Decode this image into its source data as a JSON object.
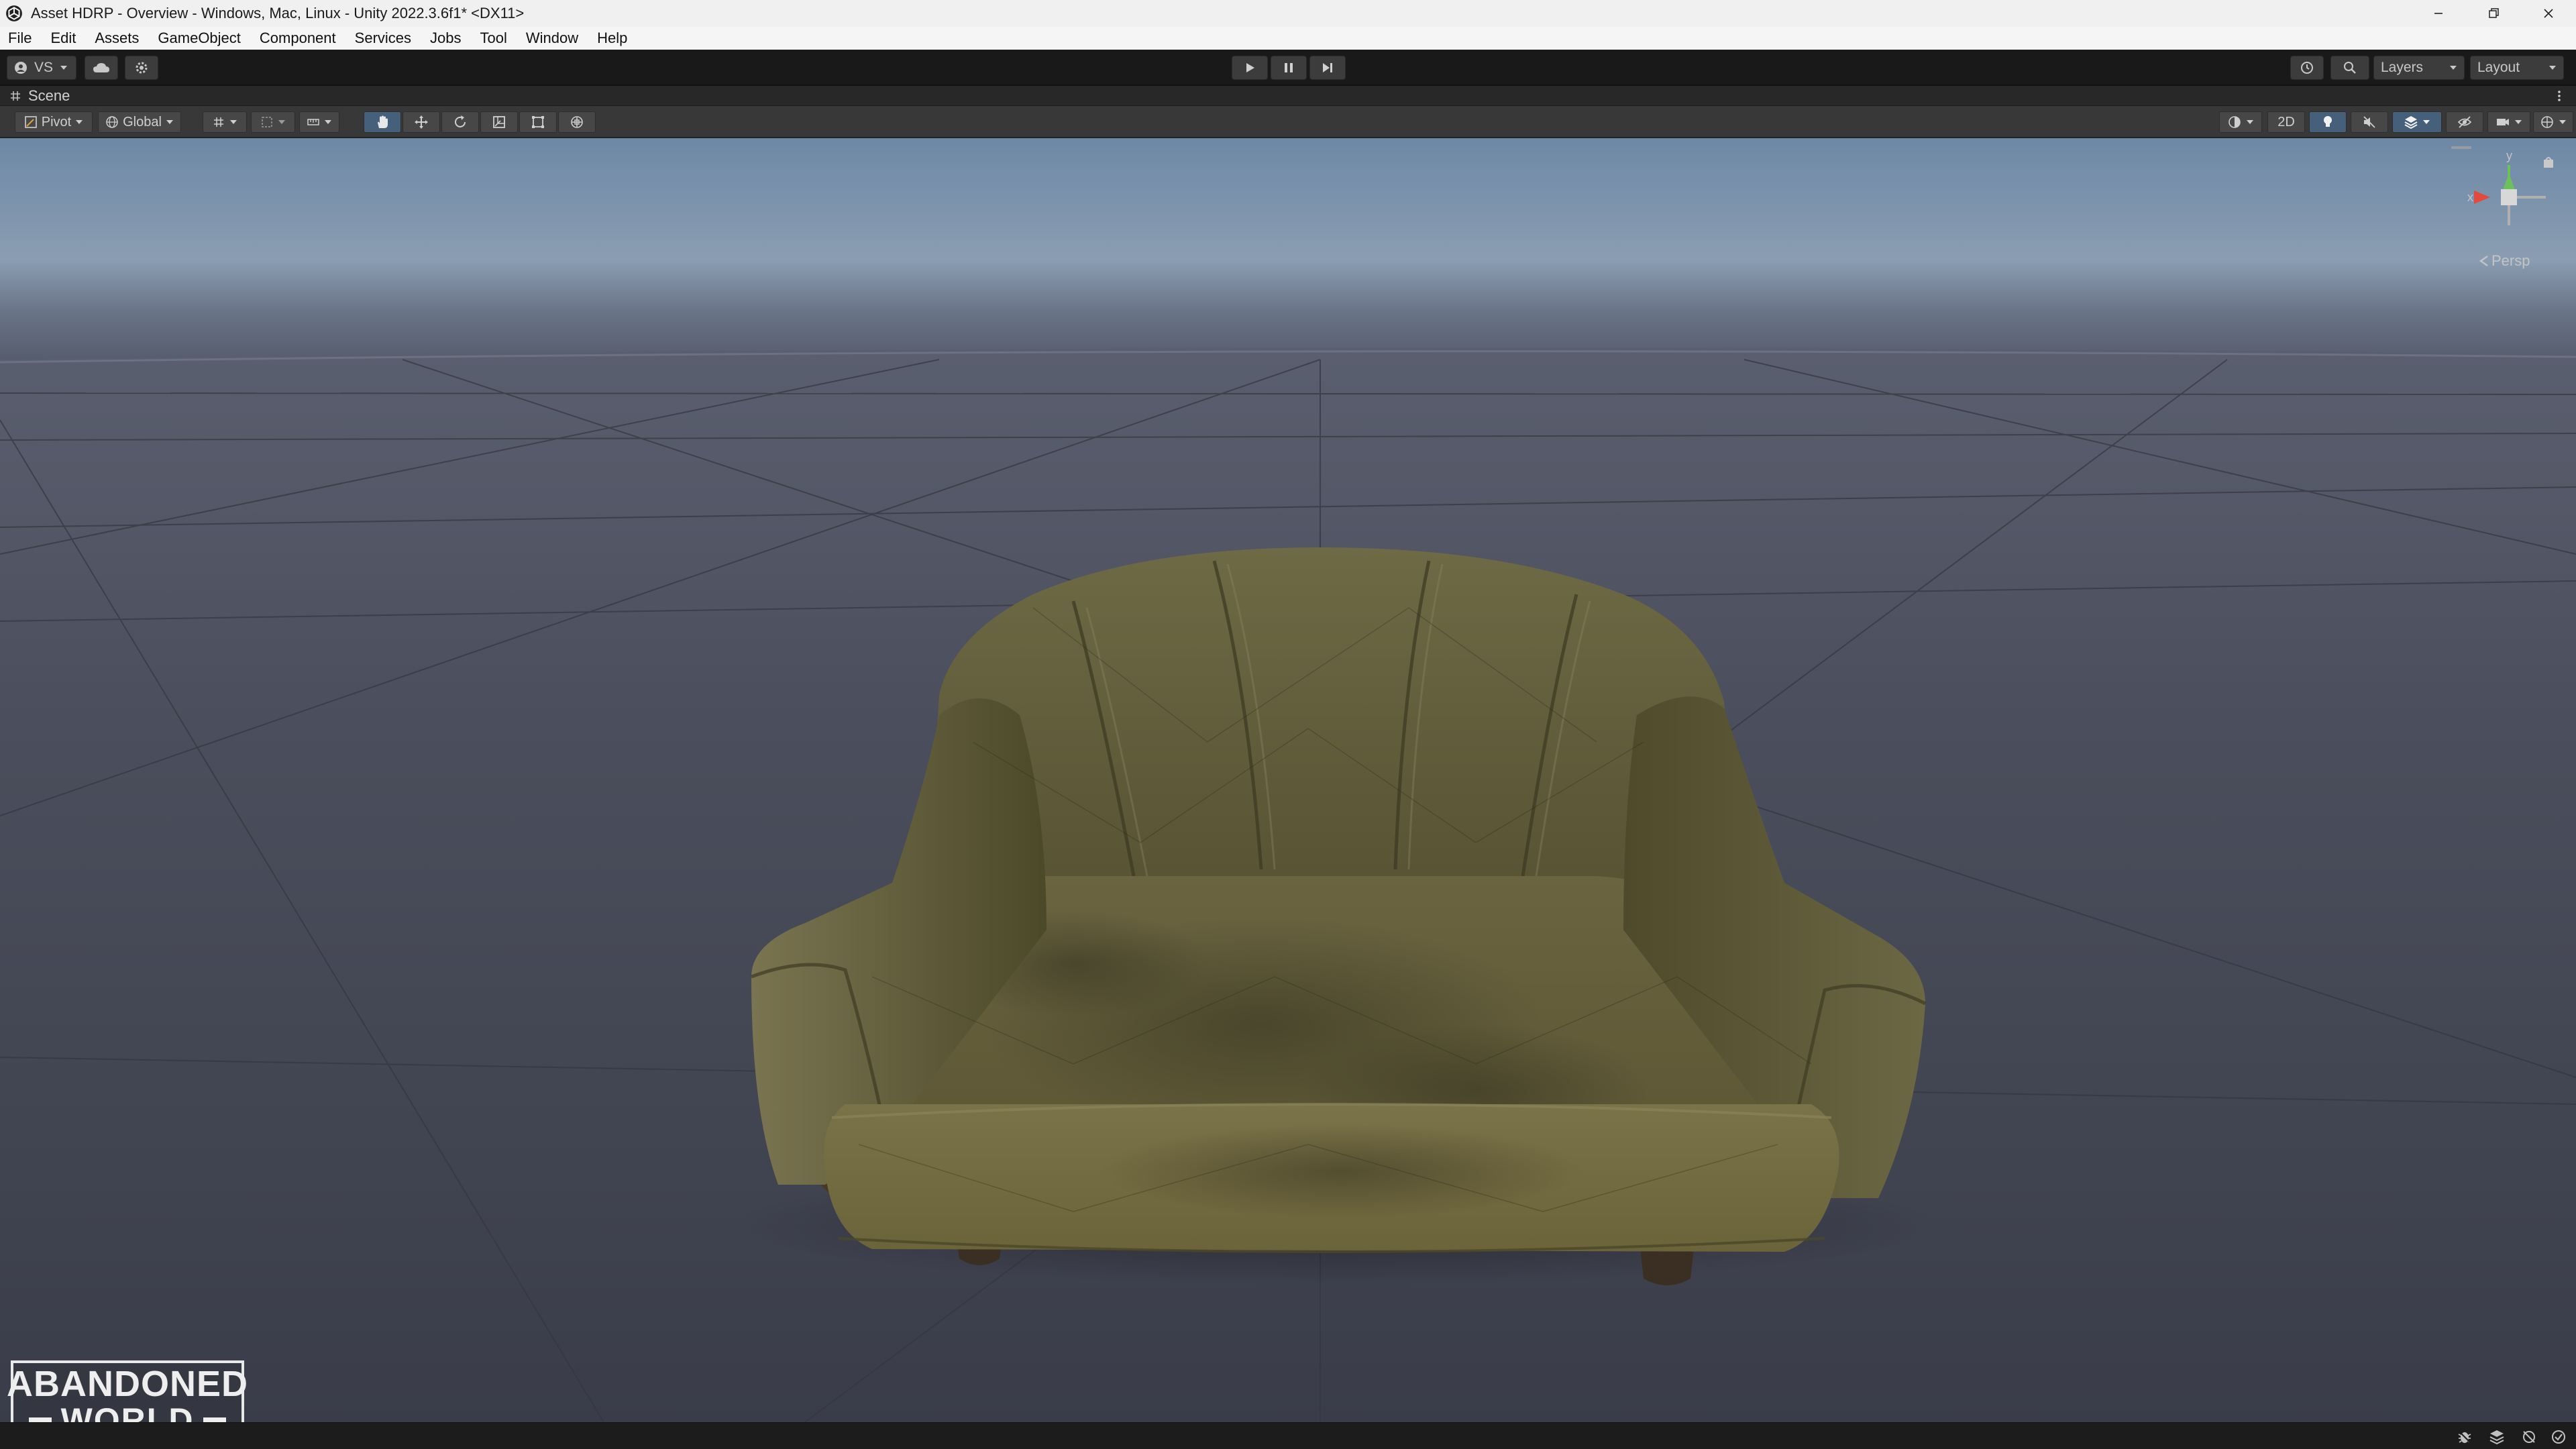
{
  "window": {
    "title": "Asset HDRP - Overview - Windows, Mac, Linux - Unity 2022.3.6f1* <DX11>"
  },
  "menu": {
    "items": [
      "File",
      "Edit",
      "Assets",
      "GameObject",
      "Component",
      "Services",
      "Jobs",
      "Tool",
      "Window",
      "Help"
    ]
  },
  "toolbar": {
    "account_label": "VS",
    "layers_label": "Layers",
    "layout_label": "Layout"
  },
  "scene": {
    "tab_label": "Scene",
    "pivot_label": "Pivot",
    "global_label": "Global",
    "mode_2d_label": "2D",
    "projection_label": "Persp",
    "gizmo_axes": {
      "x": "x",
      "y": "y"
    }
  },
  "watermark": {
    "line1": "ABANDONED",
    "line2": "WORLD"
  },
  "colors": {
    "accent_blue": "#46607c",
    "toolbar_bg": "#191919",
    "scene_toolbar_bg": "#383838",
    "sofa_fabric": "#6b6436"
  }
}
